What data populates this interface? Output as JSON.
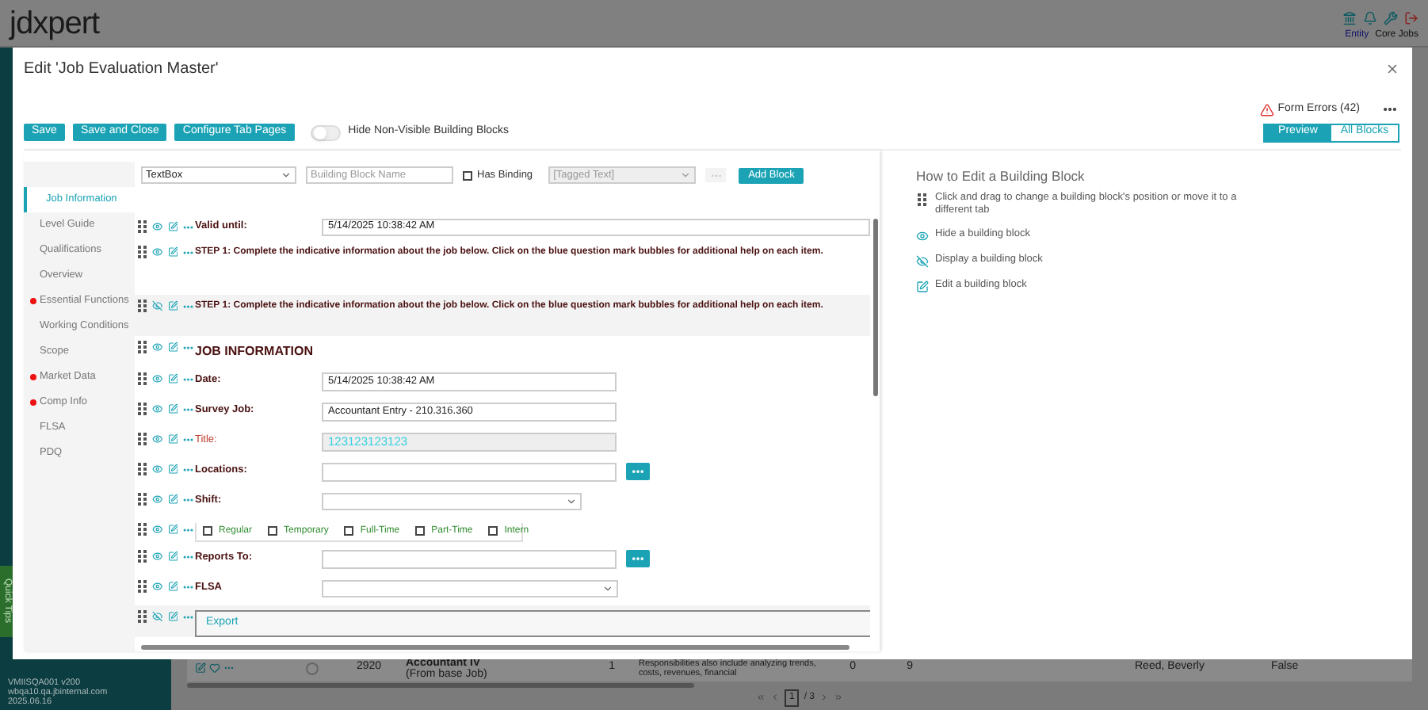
{
  "app": {
    "logo": "jdxpert",
    "header_links": [
      {
        "label": "Entity",
        "selected": true
      },
      {
        "label": "Core Jobs",
        "selected": false
      }
    ],
    "quick_tips": "Quick Tips",
    "server_info": [
      "VMIISQA001 v200",
      "wbqa10.qa.jbinternal.com",
      "2025.06.16"
    ],
    "table_row": {
      "code": "2920",
      "title": "Accountant IV",
      "subtitle": "(From base Job)",
      "column_1": "1",
      "description": "Responsibilities also include analyzing trends, costs, revenues, financial",
      "column_2": "0",
      "column_3": "9",
      "owner": "Reed, Beverly",
      "column_4": "False"
    },
    "pager": {
      "page": "1",
      "total": "/ 3"
    }
  },
  "dialog": {
    "title": "Edit 'Job Evaluation Master'",
    "form_errors": "Form Errors (42)",
    "buttons": [
      "Save",
      "Save and Close",
      "Configure Tab Pages"
    ],
    "hide_toggle": {
      "label": "Hide Non-Visible Building Blocks",
      "on": false
    },
    "view_tabs": [
      {
        "label": "Preview",
        "selected": true
      },
      {
        "label": "All Blocks",
        "selected": false
      }
    ],
    "tabs": [
      {
        "label": "Job Information",
        "selected": true,
        "error": false
      },
      {
        "label": "Level Guide",
        "selected": false,
        "error": false
      },
      {
        "label": "Qualifications",
        "selected": false,
        "error": false
      },
      {
        "label": "Overview",
        "selected": false,
        "error": false
      },
      {
        "label": "Essential Functions",
        "selected": false,
        "error": true
      },
      {
        "label": "Working Conditions",
        "selected": false,
        "error": false
      },
      {
        "label": "Scope",
        "selected": false,
        "error": false
      },
      {
        "label": "Market Data",
        "selected": false,
        "error": true
      },
      {
        "label": "Comp Info",
        "selected": false,
        "error": true
      },
      {
        "label": "FLSA",
        "selected": false,
        "error": false
      },
      {
        "label": "PDQ",
        "selected": false,
        "error": false
      }
    ],
    "toolbar": {
      "block_type": "TextBox",
      "name_placeholder": "Building Block Name",
      "has_binding": {
        "label": "Has Binding",
        "checked": false
      },
      "tagged_text": "[Tagged Text]",
      "add_button": "Add Block"
    },
    "blocks": [
      {
        "kind": "system_field",
        "label": "Valid until:",
        "value": "5/14/2025 10:38:42 AM",
        "visible": true
      },
      {
        "kind": "text",
        "text": "STEP 1: Complete the indicative information about the job below. Click on the blue question mark bubbles for additional help on each item.",
        "visible": true
      },
      {
        "kind": "text",
        "text": "STEP 1: Complete the indicative information about the job below. Click on the blue question mark bubbles for additional help on each item.",
        "visible": false
      },
      {
        "kind": "heading",
        "text": "JOB INFORMATION",
        "visible": true
      },
      {
        "kind": "input",
        "label": "Date:",
        "value": "5/14/2025 10:38:42 AM",
        "visible": true,
        "required": false,
        "disabled": false
      },
      {
        "kind": "input",
        "label": "Survey Job:",
        "value": "Accountant Entry - 210.316.360",
        "visible": true,
        "required": false,
        "disabled": false
      },
      {
        "kind": "input",
        "label": "Title:",
        "value": "123123123123",
        "visible": true,
        "required": true,
        "disabled": true
      },
      {
        "kind": "picker",
        "label": "Locations:",
        "visible": true,
        "required": false
      },
      {
        "kind": "select",
        "label": "Shift:",
        "visible": true,
        "required": false
      },
      {
        "kind": "checkboxes",
        "visible": true,
        "options": [
          {
            "label": "Regular",
            "checked": false
          },
          {
            "label": "Temporary",
            "checked": false
          },
          {
            "label": "Full-Time",
            "checked": false
          },
          {
            "label": "Part-Time",
            "checked": false
          },
          {
            "label": "Intern",
            "checked": false
          }
        ]
      },
      {
        "kind": "picker",
        "label": "Reports To:",
        "visible": true,
        "required": false
      },
      {
        "kind": "select",
        "label": "FLSA",
        "visible": true,
        "required": false
      },
      {
        "kind": "tab_group",
        "label": "Export",
        "visible": false
      }
    ],
    "help": {
      "title": "How to Edit a Building Block",
      "items": [
        {
          "kind": "drag",
          "text": "Click and drag to change a building block's position or move it to a different tab"
        },
        {
          "kind": "hide",
          "text": "Hide a building block"
        },
        {
          "kind": "display",
          "text": "Display a building block"
        },
        {
          "kind": "edit",
          "text": "Edit a building block"
        }
      ]
    }
  }
}
